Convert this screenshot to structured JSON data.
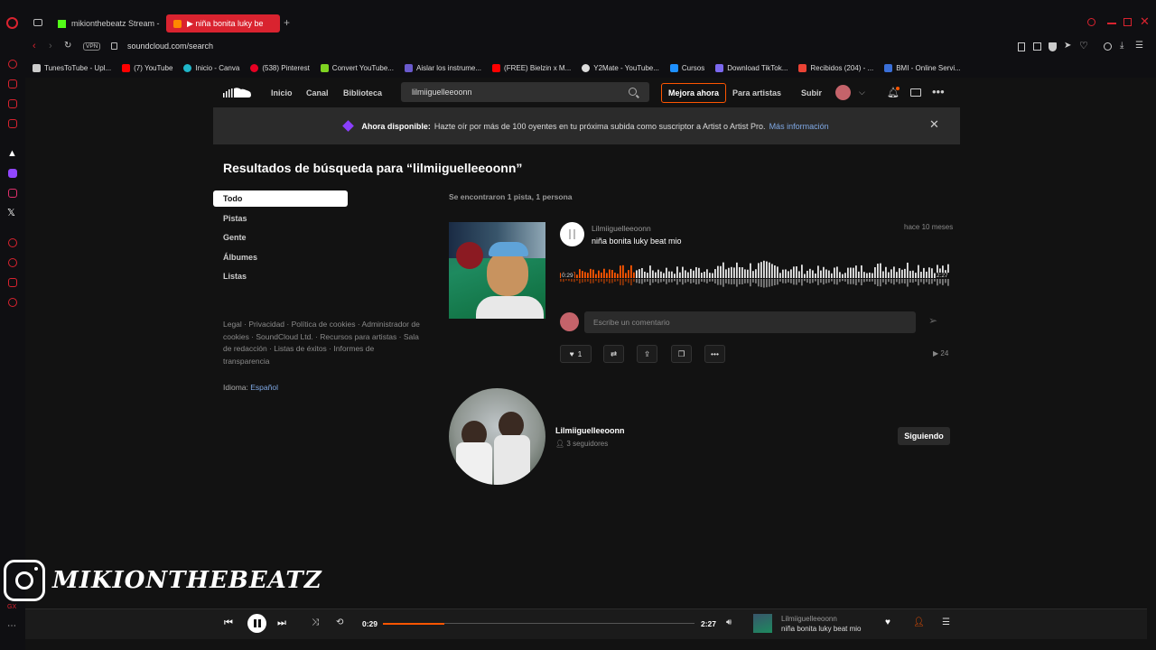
{
  "browser": {
    "tabs": [
      {
        "label": "mikionthebeatz Stream -",
        "active": false
      },
      {
        "label": "▶ niña bonita luky be",
        "active": true
      }
    ],
    "address": "soundcloud.com/search",
    "vpn_label": "VPN",
    "bookmarks": [
      "TunesToTube - Upl...",
      "(7) YouTube",
      "Inicio - Canva",
      "(538) Pinterest",
      "Convert YouTube...",
      "Aislar los instrume...",
      "(FREE) Bielzin x M...",
      "Y2Mate - YouTube...",
      "Cursos",
      "Download TikTok...",
      "Recibidos (204) - ...",
      "BMI - Online Servi..."
    ]
  },
  "header": {
    "nav": [
      "Inicio",
      "Canal",
      "Biblioteca"
    ],
    "search_value": "lilmiiguelleeoonn",
    "upgrade_label": "Mejora ahora",
    "for_artists": "Para artistas",
    "upload": "Subir"
  },
  "banner": {
    "bold": "Ahora disponible:",
    "text": "Hazte oír por más de 100 oyentes en tu próxima subida como suscriptor a Artist o Artist Pro.",
    "link": "Más información"
  },
  "results": {
    "title": "Resultados de búsqueda para “lilmiiguelleeoonn”",
    "summary": "Se encontraron 1 pista, 1 persona",
    "filters": [
      "Todo",
      "Pistas",
      "Gente",
      "Álbumes",
      "Listas"
    ]
  },
  "footer": {
    "links": "Legal · Privacidad · Política de cookies · Administrador de cookies · SoundCloud Ltd. · Recursos para artistas · Sala de redacción · Listas de éxitos · Informes de transparencia",
    "language_label": "Idioma:",
    "language_value": "Español"
  },
  "track": {
    "uploader": "Lilmiiguelleeoonn",
    "title": "niña bonita luky beat mio",
    "posted": "hace 10 meses",
    "elapsed": "0:29",
    "duration": "2:27",
    "progress": 0.197,
    "comment_placeholder": "Escribe un comentario",
    "likes": "1",
    "plays": "24"
  },
  "user": {
    "name": "Lilmiiguelleeoonn",
    "followers": "3 seguidores",
    "follow_label": "Siguiendo"
  },
  "watermark": "MIKIONTHEBEATZ",
  "player": {
    "elapsed": "0:29",
    "duration": "2:27",
    "progress": 0.197,
    "now_playing_user": "Lilmiiguelleeoonn",
    "now_playing_title": "niña bonita luky beat mio"
  },
  "colors": {
    "accent": "#ff5500",
    "browser_red": "#d9232f",
    "background": "#121212"
  }
}
